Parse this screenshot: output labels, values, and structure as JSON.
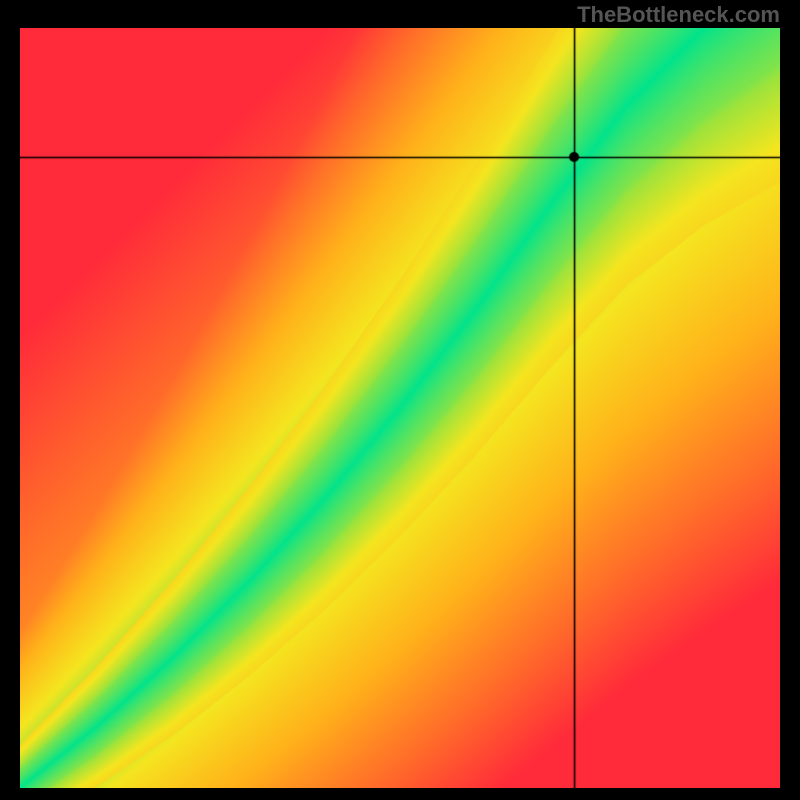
{
  "attribution": "TheBottleneck.com",
  "chart_data": {
    "type": "heatmap",
    "title": "",
    "xlabel": "",
    "ylabel": "",
    "xlim": [
      0,
      100
    ],
    "ylim": [
      0,
      100
    ],
    "crosshair": {
      "x": 73,
      "y": 83
    },
    "description": "Bottleneck heatmap. The green diagonal band indicates balanced component combinations (value ≈ 0); moving away from the band toward upper-left or lower-right shifts through yellow → orange → red indicating increasing bottleneck (value → 1). Band is slightly superlinear (steeper above the main diagonal).",
    "colorscale": [
      {
        "t": 0.0,
        "hex": "#00e38c"
      },
      {
        "t": 0.15,
        "hex": "#9ee33b"
      },
      {
        "t": 0.3,
        "hex": "#f5e51f"
      },
      {
        "t": 0.55,
        "hex": "#ffb21a"
      },
      {
        "t": 0.8,
        "hex": "#ff6a2a"
      },
      {
        "t": 1.0,
        "hex": "#ff2a3a"
      }
    ],
    "band_curve_samples": [
      {
        "x": 0,
        "y": 0
      },
      {
        "x": 10,
        "y": 8
      },
      {
        "x": 20,
        "y": 17
      },
      {
        "x": 30,
        "y": 27
      },
      {
        "x": 40,
        "y": 38
      },
      {
        "x": 50,
        "y": 50
      },
      {
        "x": 60,
        "y": 63
      },
      {
        "x": 70,
        "y": 77
      },
      {
        "x": 80,
        "y": 90
      },
      {
        "x": 90,
        "y": 100
      },
      {
        "x": 100,
        "y": 108
      }
    ]
  }
}
